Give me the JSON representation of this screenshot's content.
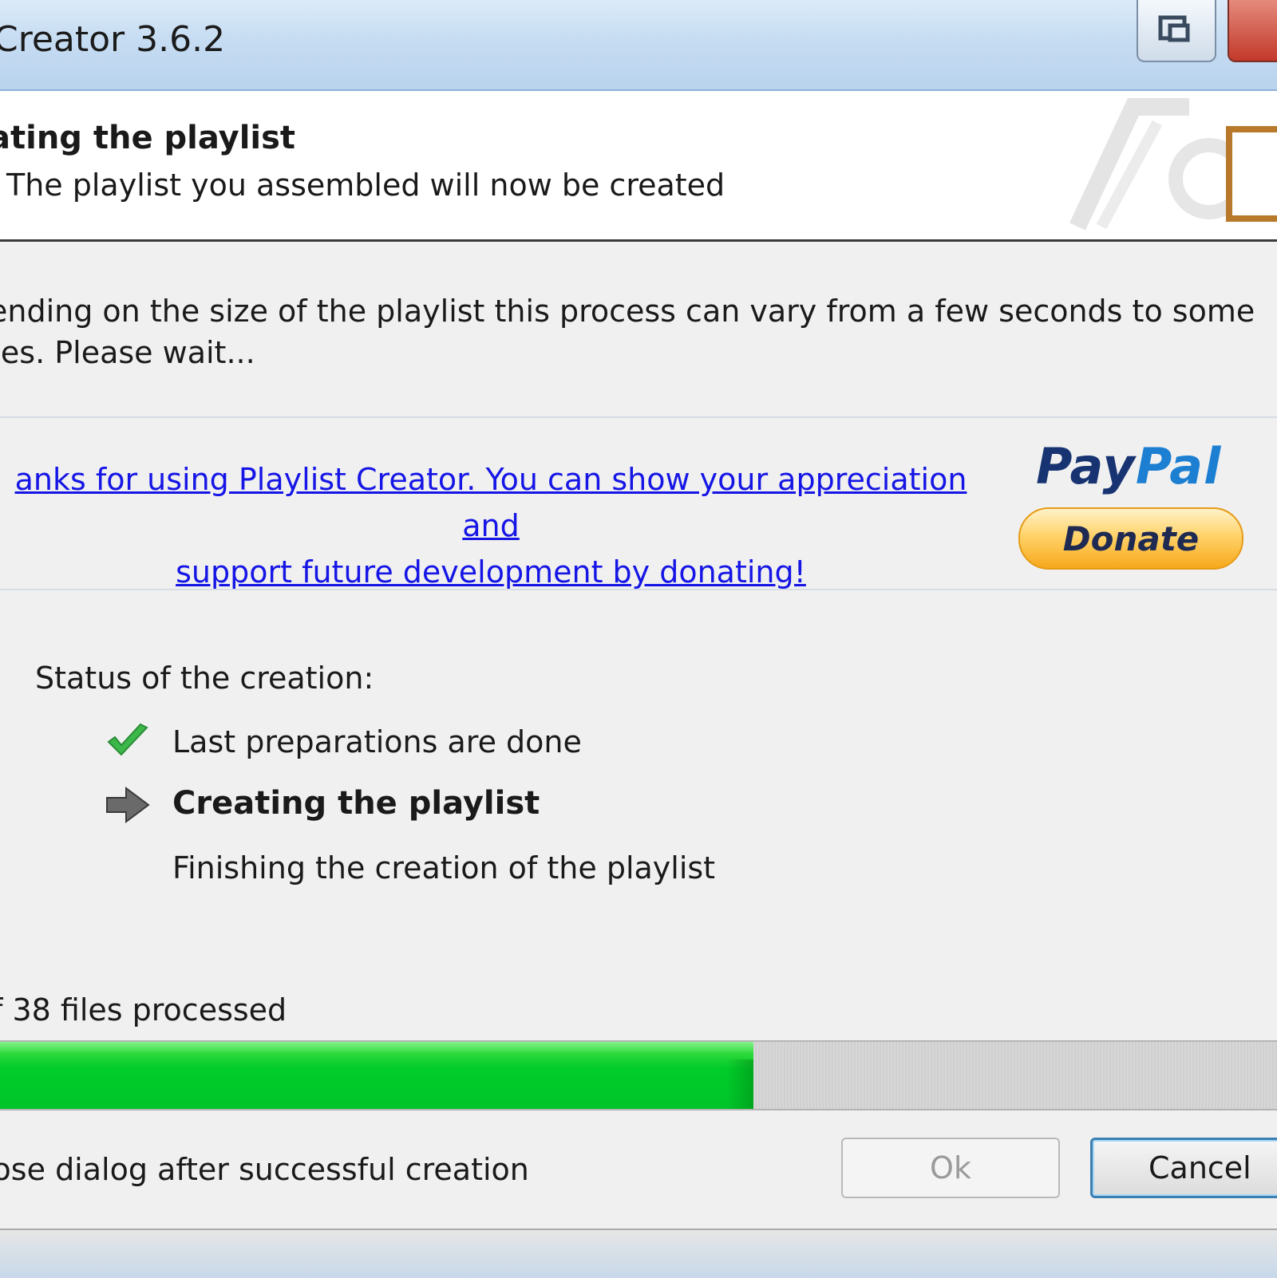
{
  "window": {
    "title": "Creator 3.6.2",
    "restore_icon": "restore-window-icon",
    "close_icon": "close-window-icon"
  },
  "header": {
    "title": "ating the playlist",
    "subtitle": "The playlist you assembled will now be created",
    "logo_icon": "playlist-logo-icon"
  },
  "info": {
    "line1": "ending on the size of the playlist this process can vary from a few seconds to some",
    "line2": "tes. Please wait..."
  },
  "donation": {
    "line1": "anks for using Playlist Creator. You can show your appreciation and",
    "line2": "support future development by donating!",
    "paypal_pay": "Pay",
    "paypal_pal": "Pal",
    "donate_label": "Donate",
    "link_color": "#1515e6"
  },
  "status": {
    "heading": "Status of the creation:",
    "steps": [
      {
        "label": "Last preparations are done",
        "icon": "check-icon",
        "state": "done"
      },
      {
        "label": "Creating the playlist",
        "icon": "arrow-right-icon",
        "state": "current"
      },
      {
        "label": "Finishing the creation of the playlist",
        "icon": "",
        "state": "pending"
      }
    ]
  },
  "progress": {
    "files_text": "f 38 files processed",
    "fraction": 0.59,
    "fill_color": "#00c52a"
  },
  "footer": {
    "close_option": "lose dialog after successful creation",
    "ok_label": "Ok",
    "cancel_label": "Cancel"
  }
}
